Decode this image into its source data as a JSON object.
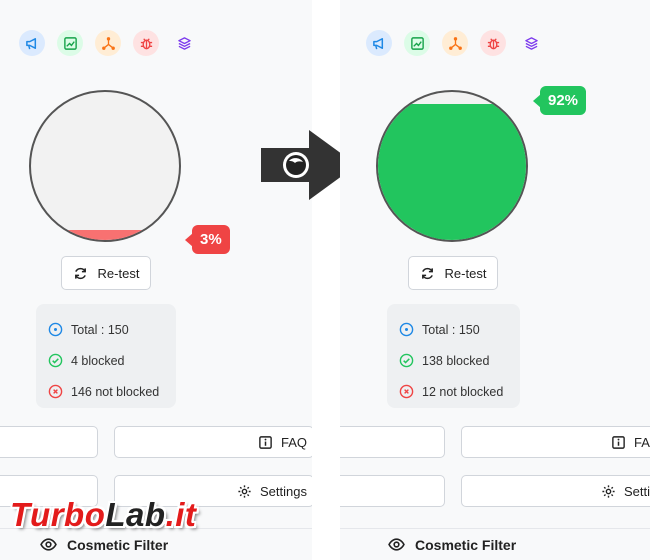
{
  "colors": {
    "green": "#22c55e",
    "red": "#ef4444",
    "blue": "#1e88e5",
    "orange": "#f97316",
    "purple": "#7c3aed"
  },
  "category_icons": [
    "megaphone-icon",
    "chart-icon",
    "analytics-icon",
    "bug-icon",
    "layers-icon"
  ],
  "left": {
    "percent_label": "3%",
    "fill_fraction": 0.03,
    "retest_label": "Re-test",
    "stats": {
      "total": "Total : 150",
      "blocked": "4 blocked",
      "not_blocked": "146 not blocked"
    },
    "faq_label": "FAQ",
    "settings_label": "Settings",
    "cosmetic_label": "Cosmetic Filter"
  },
  "right": {
    "percent_label": "92%",
    "fill_fraction": 0.92,
    "retest_label": "Re-test",
    "stats": {
      "total": "Total : 150",
      "blocked": "138 blocked",
      "not_blocked": "12 not blocked"
    },
    "faq_label": "FAQ",
    "settings_label": "Settings",
    "cosmetic_label": "Cosmetic Filter"
  },
  "watermark": {
    "part1": "Turbo",
    "part2": "Lab",
    "part3": ".it"
  }
}
